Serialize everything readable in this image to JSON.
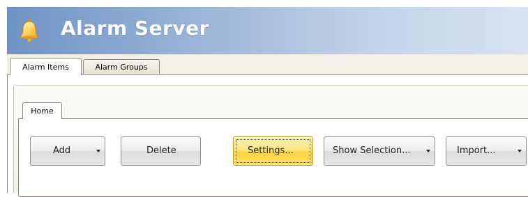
{
  "app": {
    "title": "Alarm Server",
    "icon": "bell-icon",
    "header_gradient": [
      "#6f93c3",
      "#d9e3f1"
    ]
  },
  "outer_tabs": [
    {
      "label": "Alarm Items",
      "active": true
    },
    {
      "label": "Alarm Groups",
      "active": false
    }
  ],
  "ribbon": {
    "tab": "Home",
    "buttons": [
      {
        "label": "Add",
        "dropdown": true
      },
      {
        "label": "Delete",
        "dropdown": false
      },
      {
        "label": "Settings...",
        "dropdown": false,
        "highlighted": true
      },
      {
        "label": "Show Selection...",
        "dropdown": true
      },
      {
        "label": "Import...",
        "dropdown": true
      }
    ]
  },
  "colors": {
    "highlight": "#ffd43a",
    "tab_border": "#8b857a"
  }
}
